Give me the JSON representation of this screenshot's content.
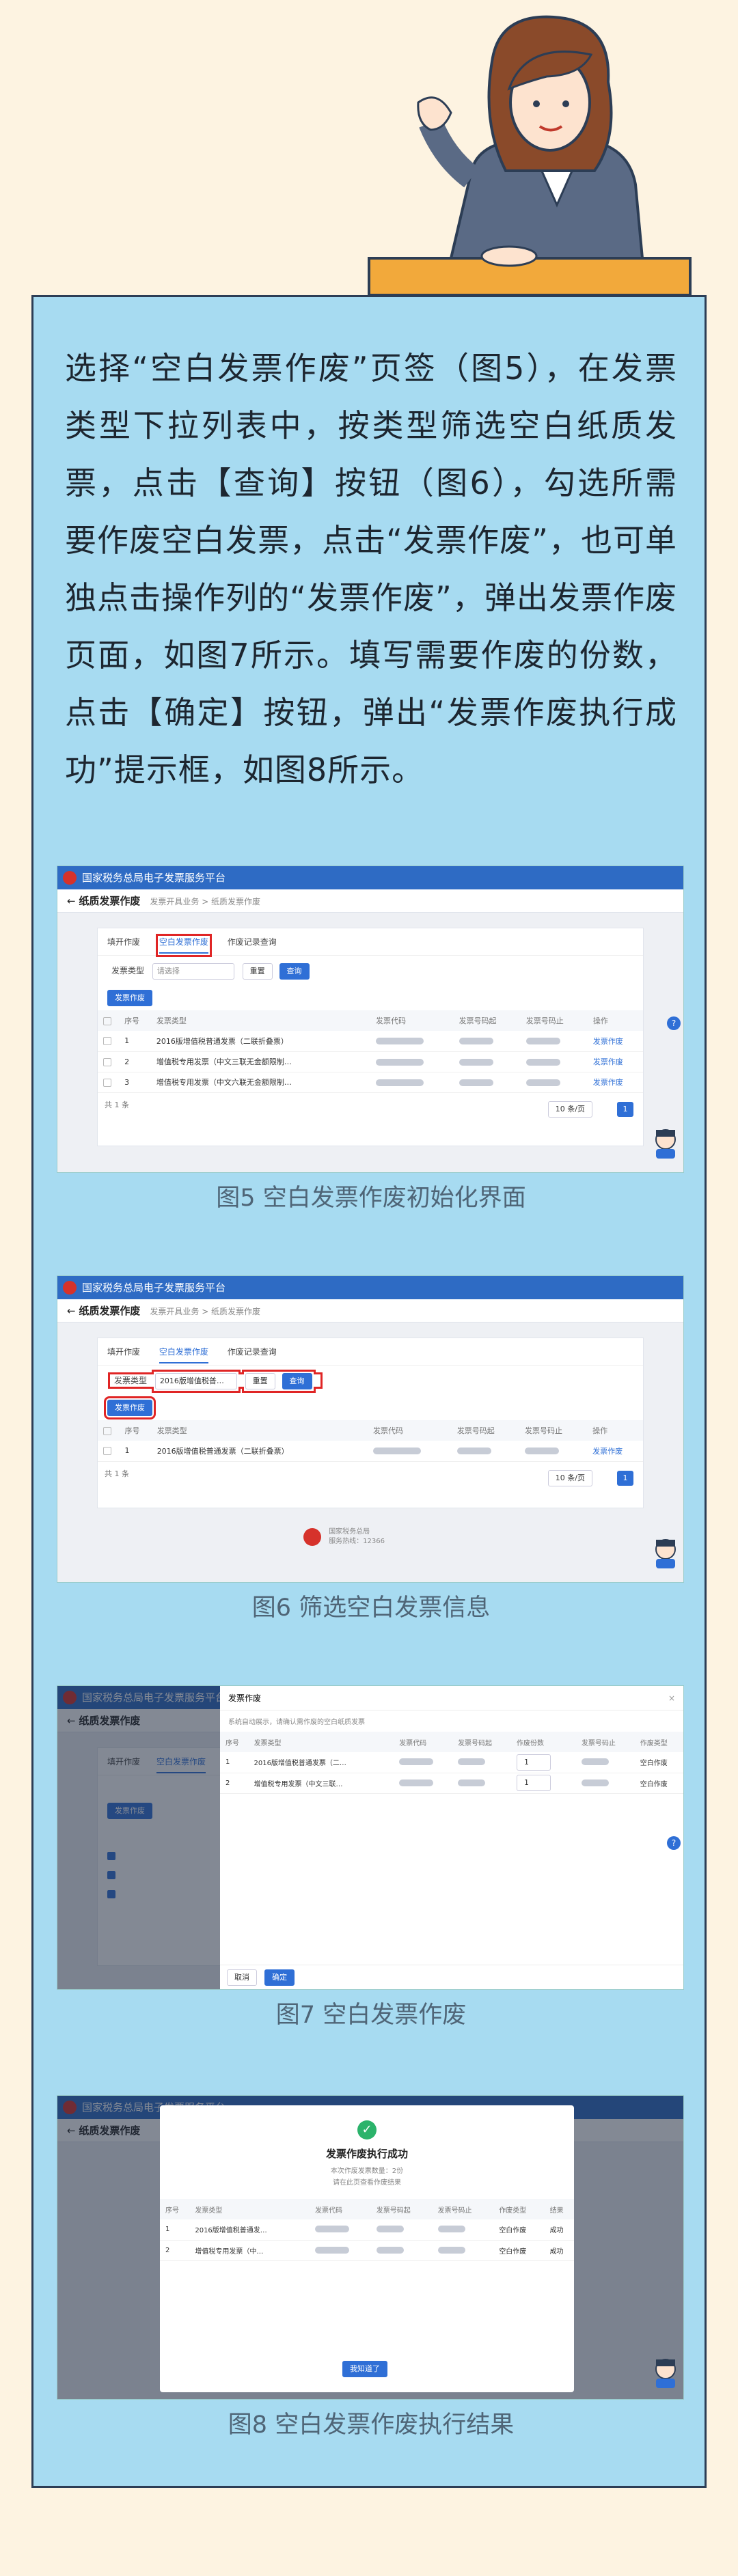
{
  "intro_text": "选择“空白发票作废”页签（图5），在发票类型下拉列表中，按类型筛选空白纸质发票，点击【查询】按钮（图6），勾选所需要作废空白发票，点击“发票作废”，也可单独点击操作列的“发票作废”，弹出发票作废页面，如图7所示。填写需要作废的份数，点击【确定】按钮，弹出“发票作废执行成功”提示框，如图8所示。",
  "platform_title": "国家税务总局电子发票服务平台",
  "page_title": "纸质发票作废",
  "breadcrumb": "发票开具业务 > 纸质发票作废",
  "tabs": [
    "填开作废",
    "空白发票作废",
    "作废记录查询"
  ],
  "filter": {
    "label": "发票类型",
    "placeholder": "请选择",
    "selected": "2016版增值税普…",
    "reset": "重置",
    "query": "查询"
  },
  "batch_button": "发票作废",
  "columns": [
    "序号",
    "发票类型",
    "发票代码",
    "发票号码起",
    "发票号码止",
    "操作"
  ],
  "rows_fig5": [
    {
      "no": "1",
      "type": "2016版增值税普通发票（二联折叠票）",
      "op": "发票作废"
    },
    {
      "no": "2",
      "type": "增值税专用发票（中文三联无金额限制…",
      "op": "发票作废"
    },
    {
      "no": "3",
      "type": "增值税专用发票（中文六联无金额限制…",
      "op": "发票作废"
    }
  ],
  "rows_fig6": [
    {
      "no": "1",
      "type": "2016版增值税普通发票（二联折叠票）",
      "op": "发票作废"
    }
  ],
  "total": "共 1 条",
  "page_size": "10 条/页",
  "page_num": "1",
  "fig6_footer": [
    "国家税务总局",
    "服务热线：12366"
  ],
  "fig7": {
    "drawer_title": "发票作废",
    "hint": "系统自动展示，请确认需作废的空白纸质发票",
    "columns": [
      "序号",
      "发票类型",
      "发票代码",
      "发票号码起",
      "作废份数",
      "发票号码止",
      "作废类型"
    ],
    "rows": [
      {
        "no": "1",
        "type": "2016版增值税普通发票（二…",
        "qty": "1",
        "kind": "空白作废"
      },
      {
        "no": "2",
        "type": "增值税专用发票（中文三联…",
        "qty": "1",
        "kind": "空白作废"
      }
    ],
    "cancel": "取消",
    "confirm": "确定"
  },
  "fig8": {
    "title": "发票作废执行成功",
    "sub1": "本次作废发票数量：2份",
    "sub2": "请在此页查看作废结果",
    "columns": [
      "序号",
      "发票类型",
      "发票代码",
      "发票号码起",
      "发票号码止",
      "作废类型",
      "结果"
    ],
    "rows": [
      {
        "no": "1",
        "type": "2016版增值税普通发…",
        "kind": "空白作废",
        "result": "成功"
      },
      {
        "no": "2",
        "type": "增值税专用发票（中…",
        "kind": "空白作废",
        "result": "成功"
      }
    ],
    "ok": "我知道了"
  },
  "captions": [
    "图5 空白发票作废初始化界面",
    "图6 筛选空白发票信息",
    "图7 空白发票作废",
    "图8 空白发票作废执行结果"
  ],
  "colors": {
    "background": "#fdf3e1",
    "card": "#a7dbf1",
    "accent": "#2f6fd6",
    "highlight": "#e02525"
  }
}
